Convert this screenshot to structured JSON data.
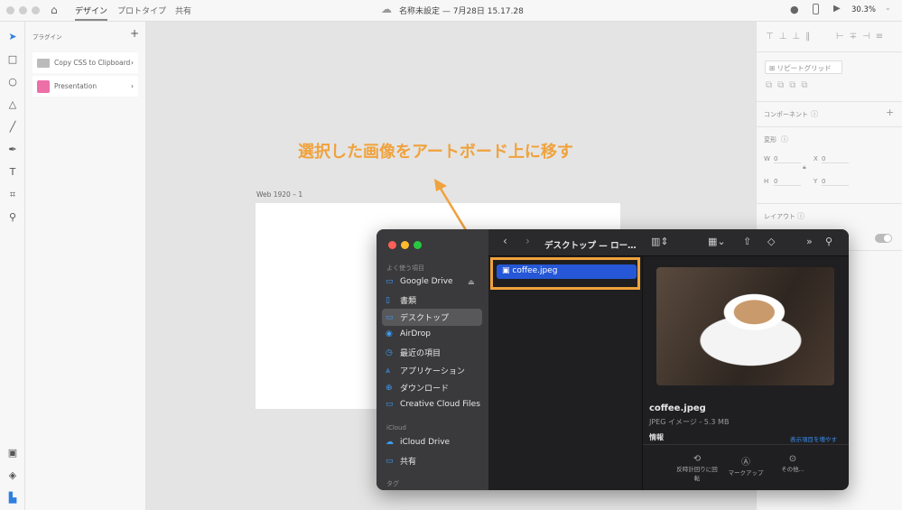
{
  "topbar": {
    "tabs": [
      "デザイン",
      "プロトタイプ",
      "共有"
    ],
    "doc_title": "名称未設定 — 7月28日 15.17.28",
    "zoom": "30.3%"
  },
  "plugins": {
    "title": "プラグイン",
    "add": "+",
    "items": [
      {
        "label": "Copy CSS to Clipboard"
      },
      {
        "label": "Presentation"
      }
    ]
  },
  "canvas": {
    "artboard_label": "Web 1920 – 1",
    "annotation": "選択した画像をアートボード上に移す",
    "annotation_color": "#f0a23c"
  },
  "right": {
    "repeat_grid": "リピートグリッド",
    "component": "コンポーネント",
    "transform": "変形",
    "w": "W",
    "w_val": "0",
    "h": "H",
    "h_val": "0",
    "x": "X",
    "x_val": "0",
    "y": "Y",
    "y_val": "0",
    "layout": "レイアウト"
  },
  "finder": {
    "title": "デスクトップ — ロー…",
    "sidebar": {
      "fav_header": "よく使う項目",
      "items": [
        "Google Drive",
        "書類",
        "デスクトップ",
        "AirDrop",
        "最近の項目",
        "アプリケーション",
        "ダウンロード",
        "Creative Cloud Files"
      ],
      "icloud_header": "iCloud",
      "icloud_items": [
        "iCloud Drive",
        "共有"
      ],
      "tags_header": "タグ"
    },
    "file": "coffee.jpeg",
    "preview": {
      "name": "coffee.jpeg",
      "kind": "JPEG イメージ - 5.3 MB",
      "info": "情報",
      "more": "表示項目を増やす",
      "actions": [
        "反時計回りに回転",
        "マークアップ",
        "その他..."
      ]
    }
  }
}
